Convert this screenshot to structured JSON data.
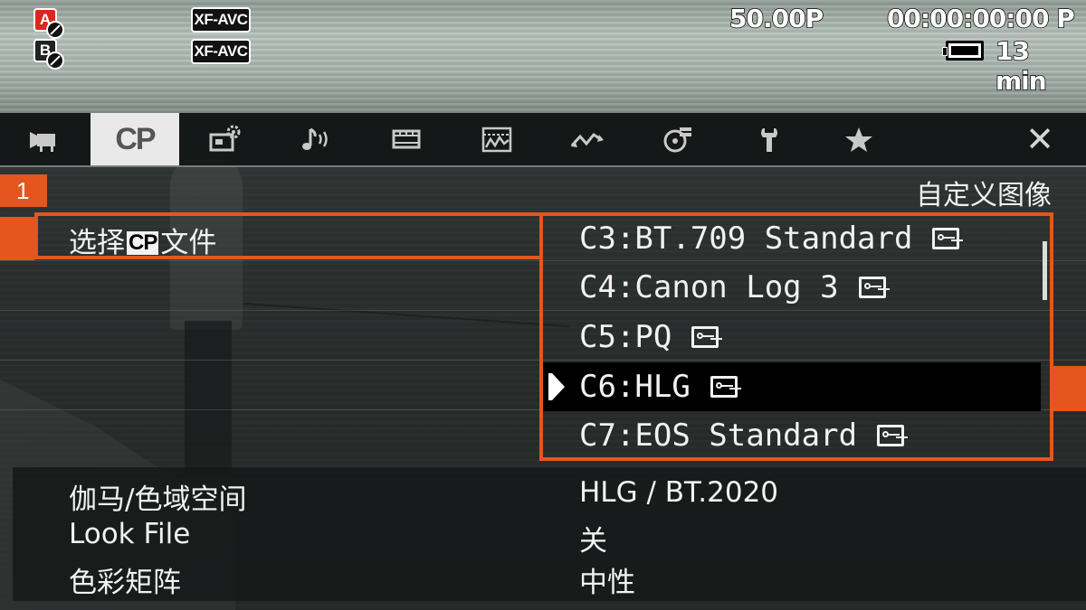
{
  "osd": {
    "slot_a": "A",
    "slot_b": "B",
    "codec_a": "XF-AVC",
    "codec_b": "XF-AVC",
    "frame_rate": "50.00P",
    "timecode": "00:00:00:00 P",
    "remaining": "13 min"
  },
  "tabs": [
    {
      "id": "camera",
      "icon": "movie-camera-icon",
      "active": false
    },
    {
      "id": "custom-picture",
      "label": "CP",
      "icon": "custom-picture-icon",
      "active": true
    },
    {
      "id": "camera-setup",
      "icon": "camera-gear-icon",
      "active": false
    },
    {
      "id": "audio",
      "icon": "audio-note-icon",
      "active": false
    },
    {
      "id": "recording",
      "icon": "film-strip-icon",
      "active": false
    },
    {
      "id": "monitoring",
      "icon": "waveform-monitor-icon",
      "active": false
    },
    {
      "id": "network",
      "icon": "network-wave-icon",
      "active": false
    },
    {
      "id": "media",
      "icon": "media-stack-icon",
      "active": false
    },
    {
      "id": "system",
      "icon": "wrench-icon",
      "active": false
    },
    {
      "id": "my-menu",
      "icon": "star-icon",
      "active": false
    },
    {
      "id": "close",
      "icon": "close-icon",
      "label": "✕",
      "active": false
    }
  ],
  "menu": {
    "page_number": "1",
    "title": "自定义图像",
    "select_row": {
      "label_before": "选择",
      "badge": "CP",
      "label_after": "文件"
    },
    "options": [
      {
        "label": "C3:BT.709 Standard",
        "locked": true,
        "selected": false
      },
      {
        "label": "C4:Canon Log 3",
        "locked": true,
        "selected": false
      },
      {
        "label": "C5:PQ",
        "locked": true,
        "selected": false
      },
      {
        "label": "C6:HLG",
        "locked": true,
        "selected": true
      },
      {
        "label": "C7:EOS Standard",
        "locked": true,
        "selected": false
      }
    ],
    "rows": [
      {
        "label": "伽马/色域空间",
        "value": "HLG / BT.2020"
      },
      {
        "label": "Look File",
        "value": "关"
      },
      {
        "label": "色彩矩阵",
        "value": "中性"
      }
    ]
  },
  "colors": {
    "accent": "#e4561d",
    "tab_active_bg": "#e9e9e9",
    "selected_option_bg": "#000000"
  }
}
